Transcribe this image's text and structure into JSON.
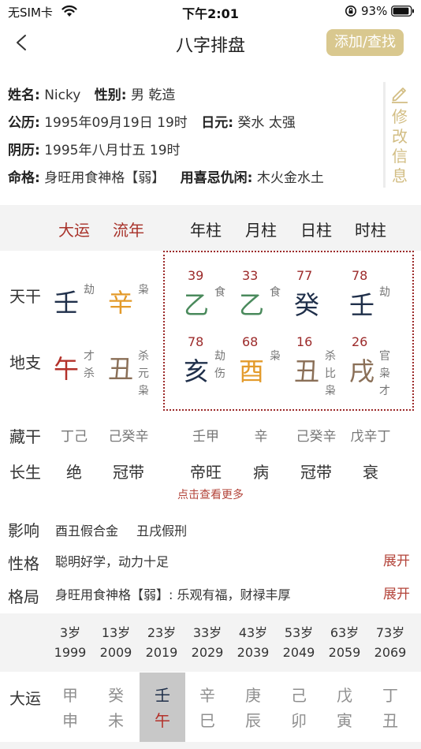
{
  "status_bar": {
    "carrier": "无SIM卡",
    "time": "下午2:01",
    "battery_percent": "93%",
    "battery_level": 0.93
  },
  "nav": {
    "title": "八字排盘",
    "action_button": "添加/查找"
  },
  "info": {
    "name_key": "姓名:",
    "name_val": "Nicky",
    "gender_key": "性别:",
    "gender_val": "男 乾造",
    "solar_key": "公历:",
    "solar_val": "1995年09月19日 19时",
    "dayun_key": "日元:",
    "dayun_val": "癸水 太强",
    "lunar_key": "阴历:",
    "lunar_val": "1995年八月廿五 19时",
    "mingge_key": "命格:",
    "mingge_val": "身旺用食神格【弱】",
    "yongxi_key": "用喜忌仇闲:",
    "yongxi_val": "木火金水土",
    "edit_chars": [
      "修",
      "改",
      "信",
      "息"
    ]
  },
  "headers": [
    "大运",
    "流年",
    "年柱",
    "月柱",
    "日柱",
    "时柱"
  ],
  "row_labels": {
    "tiangan": "天干",
    "dizhi": "地支",
    "canggan": "藏干",
    "changsheng": "长生"
  },
  "tiangan": [
    {
      "num": "",
      "char": "壬",
      "gods": [
        "劫"
      ],
      "color": "#1f2f4a"
    },
    {
      "num": "",
      "char": "辛",
      "gods": [
        "枭"
      ],
      "color": "#e39a2a"
    },
    {
      "num": "39",
      "char": "乙",
      "gods": [
        "食"
      ],
      "color": "#4a8a5c"
    },
    {
      "num": "33",
      "char": "乙",
      "gods": [
        "食"
      ],
      "color": "#4a8a5c"
    },
    {
      "num": "77",
      "char": "癸",
      "gods": [],
      "color": "#1f2f4a"
    },
    {
      "num": "78",
      "char": "壬",
      "gods": [
        "劫"
      ],
      "color": "#1f2f4a"
    }
  ],
  "dizhi": [
    {
      "num": "",
      "char": "午",
      "gods": [
        "才",
        "杀"
      ],
      "color": "#b3312a"
    },
    {
      "num": "",
      "char": "丑",
      "gods": [
        "杀",
        "元",
        "枭"
      ],
      "color": "#8a6f57"
    },
    {
      "num": "78",
      "char": "亥",
      "gods": [
        "劫",
        "伤"
      ],
      "color": "#1f2f4a"
    },
    {
      "num": "68",
      "char": "酉",
      "gods": [
        "枭"
      ],
      "color": "#e39a2a"
    },
    {
      "num": "16",
      "char": "丑",
      "gods": [
        "杀",
        "比",
        "枭"
      ],
      "color": "#8a6f57"
    },
    {
      "num": "26",
      "char": "戌",
      "gods": [
        "官",
        "枭",
        "才"
      ],
      "color": "#8a6f57"
    }
  ],
  "canggan": [
    "丁己",
    "己癸辛",
    "壬甲",
    "辛",
    "己癸辛",
    "戊辛丁"
  ],
  "changsheng": [
    "绝",
    "冠带",
    "帝旺",
    "病",
    "冠带",
    "衰"
  ],
  "more_link": "点击查看更多",
  "lines": {
    "yingxiang_label": "影响",
    "yingxiang_a": "酉丑假合金",
    "yingxiang_b": "丑戌假刑",
    "xingge_label": "性格",
    "xingge_text": "聪明好学，动力十足",
    "xingge_expand": "展开",
    "geju_label": "格局",
    "geju_text": "身旺用食神格【弱】: 乐观有福，财禄丰厚",
    "geju_expand": "展开"
  },
  "dayun_ages": [
    {
      "age": "3岁",
      "year": "1999"
    },
    {
      "age": "13岁",
      "year": "2009"
    },
    {
      "age": "23岁",
      "year": "2019"
    },
    {
      "age": "33岁",
      "year": "2029"
    },
    {
      "age": "43岁",
      "year": "2039"
    },
    {
      "age": "53岁",
      "year": "2049"
    },
    {
      "age": "63岁",
      "year": "2059"
    },
    {
      "age": "73岁",
      "year": "2069"
    }
  ],
  "dayun_label": "大运",
  "dayun": [
    {
      "gan": "甲",
      "zhi": "申"
    },
    {
      "gan": "癸",
      "zhi": "未"
    },
    {
      "gan": "壬",
      "zhi": "午",
      "selected": true
    },
    {
      "gan": "辛",
      "zhi": "巳"
    },
    {
      "gan": "庚",
      "zhi": "辰"
    },
    {
      "gan": "己",
      "zhi": "卯"
    },
    {
      "gan": "戊",
      "zhi": "寅"
    },
    {
      "gan": "丁",
      "zhi": "丑"
    }
  ],
  "colors": {
    "accent_gold": "#d9c88f",
    "accent_red": "#b3443a",
    "box_border": "#9c2a2a",
    "muted_band": "#f3f3f3"
  }
}
